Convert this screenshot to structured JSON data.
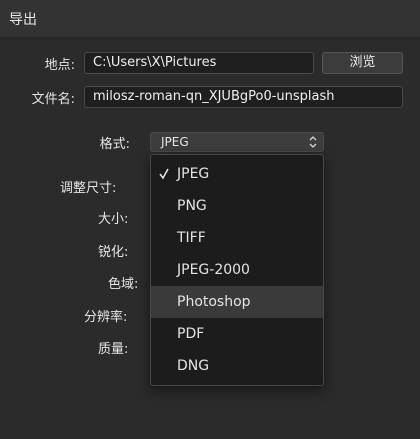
{
  "window": {
    "title": "导出"
  },
  "location": {
    "label": "地点:",
    "value": "C:\\Users\\X\\Pictures",
    "browse_label": "浏览"
  },
  "filename": {
    "label": "文件名:",
    "value": "milosz-roman-qn_XJUBgPo0-unsplash"
  },
  "format": {
    "label": "格式:",
    "selected": "JPEG"
  },
  "settings": {
    "resize_label": "调整尺寸:",
    "size_label": "大小:",
    "sharpen_label": "锐化:",
    "colorspace_label": "色域:",
    "resolution_label": "分辨率:",
    "quality_label": "质量:"
  },
  "format_menu": {
    "items": [
      {
        "label": "JPEG",
        "checked": true
      },
      {
        "label": "PNG"
      },
      {
        "label": "TIFF"
      },
      {
        "label": "JPEG-2000"
      },
      {
        "label": "Photoshop",
        "hovered": true
      },
      {
        "label": "PDF"
      },
      {
        "label": "DNG"
      }
    ]
  }
}
